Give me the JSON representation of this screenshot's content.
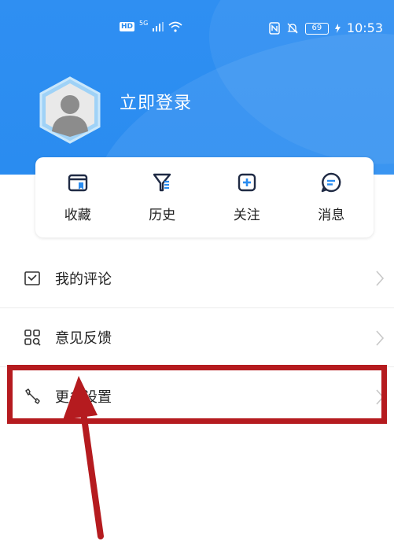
{
  "status_bar": {
    "hd_label": "HD",
    "network_label": "5G",
    "battery_level": "69",
    "time": "10:53"
  },
  "profile": {
    "login_label": "立即登录"
  },
  "quick_actions": [
    {
      "label": "收藏",
      "icon": "bookmark-folder-icon"
    },
    {
      "label": "历史",
      "icon": "history-filter-icon"
    },
    {
      "label": "关注",
      "icon": "add-follow-icon"
    },
    {
      "label": "消息",
      "icon": "message-icon"
    }
  ],
  "menu": [
    {
      "label": "我的评论",
      "icon": "comment-icon"
    },
    {
      "label": "意见反馈",
      "icon": "feedback-grid-icon"
    },
    {
      "label": "更多设置",
      "icon": "wrench-icon"
    }
  ],
  "colors": {
    "header_blue": "#2a8cf0",
    "icon_dark": "#1f2a44",
    "annotation_red": "#b51b1f"
  }
}
